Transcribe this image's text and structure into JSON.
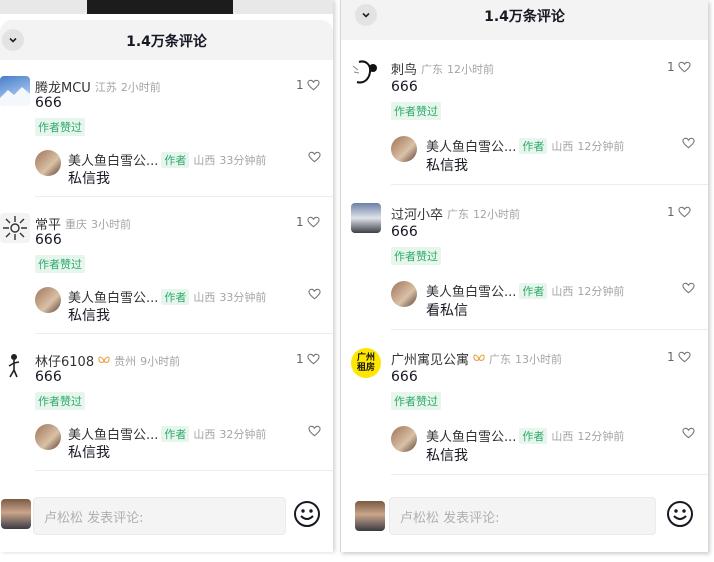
{
  "left": {
    "title": "1.4万条评论",
    "input_placeholder": "卢松松 发表评论:",
    "comments": [
      {
        "user": "腾龙MCU",
        "region": "江苏",
        "time": "2小时前",
        "text": "666",
        "likes": "1",
        "liked_badge": "作者赞过",
        "reply": {
          "user": "美人鱼白雪公...",
          "badge": "作者",
          "region": "山西",
          "time": "33分钟前",
          "text": "私信我"
        }
      },
      {
        "user": "常平",
        "region": "重庆",
        "time": "3小时前",
        "text": "666",
        "likes": "1",
        "liked_badge": "作者赞过",
        "reply": {
          "user": "美人鱼白雪公...",
          "badge": "作者",
          "region": "山西",
          "time": "33分钟前",
          "text": "私信我"
        }
      },
      {
        "user": "林仔6108",
        "region": "贵州",
        "time": "9小时前",
        "text": "666",
        "likes": "1",
        "liked_badge": "作者赞过",
        "reply": {
          "user": "美人鱼白雪公...",
          "badge": "作者",
          "region": "山西",
          "time": "32分钟前",
          "text": "私信我"
        }
      }
    ]
  },
  "right": {
    "title": "1.4万条评论",
    "input_placeholder": "卢松松 发表评论:",
    "comments": [
      {
        "user": "刺鸟",
        "region": "广东",
        "time": "12小时前",
        "text": "666",
        "likes": "1",
        "liked_badge": "作者赞过",
        "reply": {
          "user": "美人鱼白雪公...",
          "badge": "作者",
          "region": "山西",
          "time": "12分钟前",
          "text": "私信我"
        }
      },
      {
        "user": "过河小卒",
        "region": "广东",
        "time": "12小时前",
        "text": "666",
        "likes": "1",
        "liked_badge": "作者赞过",
        "reply": {
          "user": "美人鱼白雪公...",
          "badge": "作者",
          "region": "山西",
          "time": "12分钟前",
          "text": "看私信"
        }
      },
      {
        "user": "广州寓见公寓",
        "region": "广东",
        "time": "13小时前",
        "text": "666",
        "likes": "1",
        "liked_badge": "作者赞过",
        "avatar_text": [
          "广州",
          "租房"
        ],
        "reply": {
          "user": "美人鱼白雪公...",
          "badge": "作者",
          "region": "山西",
          "time": "12分钟前",
          "text": "私信我"
        }
      }
    ]
  },
  "colors": {
    "green_badge": "#2fa86b",
    "badge_bg": "#e6f6ed",
    "meta_gray": "#a4a4a8"
  },
  "icons": [
    "chevron-down-icon",
    "heart-outline-icon",
    "smiley-emoji-icon",
    "butterfly-badge-icon"
  ]
}
